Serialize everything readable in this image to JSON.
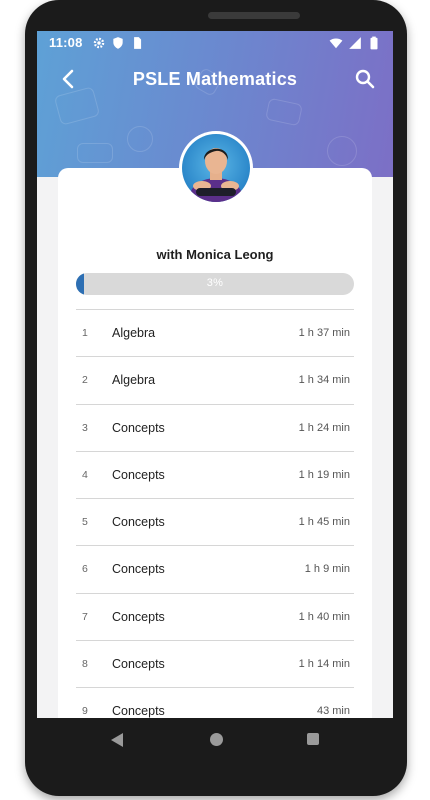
{
  "status_bar": {
    "time": "11:08",
    "left_icons": [
      "gear-icon",
      "shield-icon",
      "sim-card-icon"
    ],
    "right_icons": [
      "wifi-icon",
      "cellular-signal-icon",
      "battery-icon"
    ]
  },
  "header": {
    "title": "PSLE Mathematics",
    "back_icon": "arrow-back-icon",
    "search_icon": "search-icon",
    "accent_colors": [
      "#5ea1d6",
      "#7c6fc6"
    ]
  },
  "course": {
    "tutor_line": "with Monica Leong",
    "progress": {
      "label": "3%",
      "value_percent": 3,
      "fill_color": "#2d6fb3"
    }
  },
  "lessons": [
    {
      "number": "1",
      "title": "Algebra",
      "duration": "1 h 37 min"
    },
    {
      "number": "2",
      "title": "Algebra",
      "duration": "1 h 34 min"
    },
    {
      "number": "3",
      "title": "Concepts",
      "duration": "1 h 24 min"
    },
    {
      "number": "4",
      "title": "Concepts",
      "duration": "1 h 19 min"
    },
    {
      "number": "5",
      "title": "Concepts",
      "duration": "1 h 45 min"
    },
    {
      "number": "6",
      "title": "Concepts",
      "duration": "1 h 9 min"
    },
    {
      "number": "7",
      "title": "Concepts",
      "duration": "1 h 40 min"
    },
    {
      "number": "8",
      "title": "Concepts",
      "duration": "1 h 14 min"
    },
    {
      "number": "9",
      "title": "Concepts",
      "duration": "43 min"
    }
  ],
  "nav_bar": {
    "icons": [
      "nav-back-icon",
      "nav-home-icon",
      "nav-recents-icon"
    ]
  }
}
